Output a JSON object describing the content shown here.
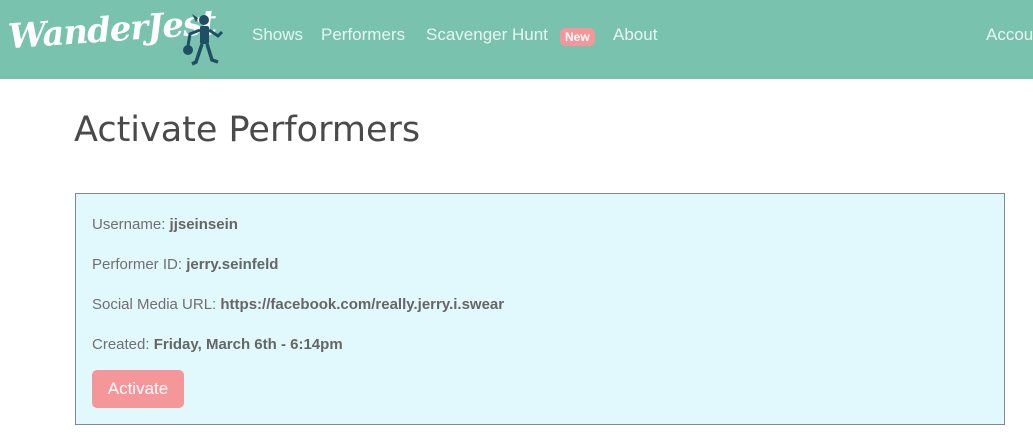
{
  "brand": {
    "name": "WanderJest"
  },
  "nav": {
    "shows": "Shows",
    "performers": "Performers",
    "scavenger_hunt": "Scavenger Hunt",
    "new_badge": "New",
    "about": "About",
    "account": "Accou"
  },
  "page": {
    "title": "Activate Performers"
  },
  "performer": {
    "username_label": "Username:",
    "username": "jjseinsein",
    "performer_id_label": "Performer ID:",
    "performer_id": "jerry.seinfeld",
    "social_label": "Social Media URL:",
    "social_url": "https://facebook.com/really.jerry.i.swear",
    "created_label": "Created:",
    "created": "Friday, March 6th - 6:14pm",
    "activate_label": "Activate"
  },
  "colors": {
    "navbar": "#79c3ae",
    "card_bg": "#e1f8fd",
    "accent": "#f4969a"
  }
}
